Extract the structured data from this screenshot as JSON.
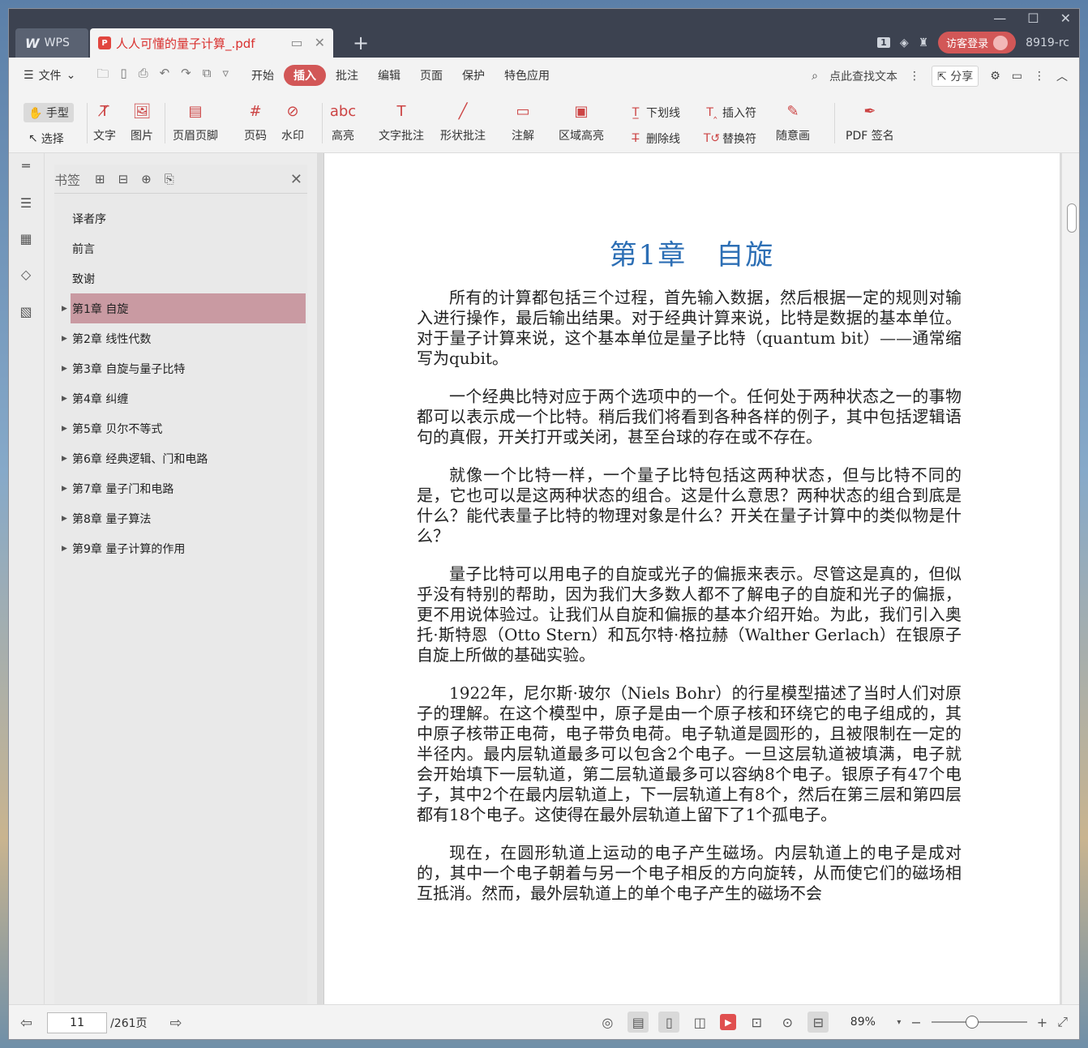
{
  "titlebar": {
    "app_tab": "WPS",
    "doc_tab": "人人可懂的量子计算_.pdf",
    "doc_badge": "P",
    "count": "1",
    "login_label": "访客登录",
    "user_id": "8919-rc"
  },
  "menu": {
    "file_label": "文件",
    "items": [
      "开始",
      "插入",
      "批注",
      "编辑",
      "页面",
      "保护",
      "特色应用"
    ],
    "active": "插入",
    "search_label": "点此查找文本",
    "share_label": "分享"
  },
  "toolbar": {
    "hand_label": "手型",
    "select_label": "选择",
    "text_label": "文字",
    "image_label": "图片",
    "header_footer_label": "页眉页脚",
    "page_num_label": "页码",
    "watermark_label": "水印",
    "highlight_label": "高亮",
    "text_comment_label": "文字批注",
    "shape_comment_label": "形状批注",
    "note_label": "注解",
    "area_highlight_label": "区域高亮",
    "underline_label": "下划线",
    "strikethrough_label": "删除线",
    "insert_mark_label": "插入符",
    "replace_mark_label": "替换符",
    "freehand_label": "随意画",
    "pdf_sign_label": "PDF 签名"
  },
  "bookmarks": {
    "title": "书签",
    "items": [
      {
        "label": "译者序",
        "expandable": false
      },
      {
        "label": "前言",
        "expandable": false
      },
      {
        "label": "致谢",
        "expandable": false
      },
      {
        "label": "第1章 自旋",
        "expandable": true
      },
      {
        "label": "第2章 线性代数",
        "expandable": true
      },
      {
        "label": "第3章 自旋与量子比特",
        "expandable": true
      },
      {
        "label": "第4章 纠缠",
        "expandable": true
      },
      {
        "label": "第5章 贝尔不等式",
        "expandable": true
      },
      {
        "label": "第6章 经典逻辑、门和电路",
        "expandable": true
      },
      {
        "label": "第7章 量子门和电路",
        "expandable": true
      },
      {
        "label": "第8章 量子算法",
        "expandable": true
      },
      {
        "label": "第9章 量子计算的作用",
        "expandable": true
      }
    ],
    "active_index": 3
  },
  "document": {
    "chapter_title": "第1章　自旋",
    "paragraphs": [
      "所有的计算都包括三个过程，首先输入数据，然后根据一定的规则对输入进行操作，最后输出结果。对于经典计算来说，比特是数据的基本单位。对于量子计算来说，这个基本单位是量子比特（quantum bit）——通常缩写为qubit。",
      "一个经典比特对应于两个选项中的一个。任何处于两种状态之一的事物都可以表示成一个比特。稍后我们将看到各种各样的例子，其中包括逻辑语句的真假，开关打开或关闭，甚至台球的存在或不存在。",
      "就像一个比特一样，一个量子比特包括这两种状态，但与比特不同的是，它也可以是这两种状态的组合。这是什么意思？两种状态的组合到底是什么？能代表量子比特的物理对象是什么？开关在量子计算中的类似物是什么？",
      "量子比特可以用电子的自旋或光子的偏振来表示。尽管这是真的，但似乎没有特别的帮助，因为我们大多数人都不了解电子的自旋和光子的偏振，更不用说体验过。让我们从自旋和偏振的基本介绍开始。为此，我们引入奥托·斯特恩（Otto Stern）和瓦尔特·格拉赫（Walther Gerlach）在银原子自旋上所做的基础实验。",
      "1922年，尼尔斯·玻尔（Niels Bohr）的行星模型描述了当时人们对原子的理解。在这个模型中，原子是由一个原子核和环绕它的电子组成的，其中原子核带正电荷，电子带负电荷。电子轨道是圆形的，且被限制在一定的半径内。最内层轨道最多可以包含2个电子。一旦这层轨道被填满，电子就会开始填下一层轨道，第二层轨道最多可以容纳8个电子。银原子有47个电子，其中2个在最内层轨道上，下一层轨道上有8个，然后在第三层和第四层都有18个电子。这使得在最外层轨道上留下了1个孤电子。",
      "现在，在圆形轨道上运动的电子产生磁场。内层轨道上的电子是成对的，其中一个电子朝着与另一个电子相反的方向旋转，从而使它们的磁场相互抵消。然而，最外层轨道上的单个电子产生的磁场不会"
    ]
  },
  "status": {
    "current_page": "11",
    "total_pages": "/261页",
    "zoom": "89%"
  },
  "colors": {
    "accent": "#d25757",
    "chapter_title": "#2d6fb5",
    "active_bookmark": "#c99aa2"
  }
}
